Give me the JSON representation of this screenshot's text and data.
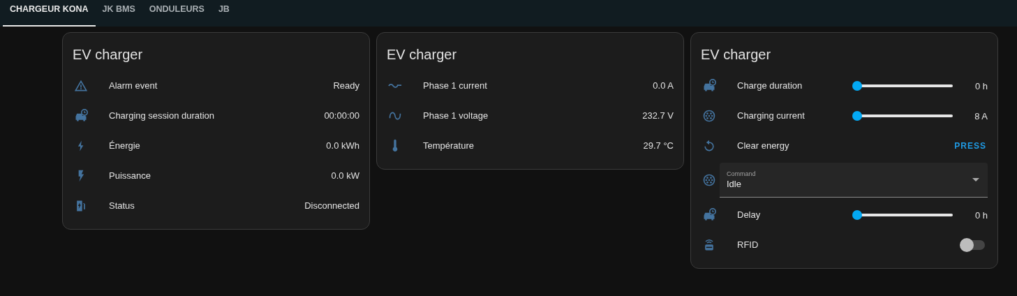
{
  "tabs": [
    {
      "label": "CHARGEUR KONA",
      "selected": true
    },
    {
      "label": "JK BMS",
      "selected": false
    },
    {
      "label": "ONDULEURS",
      "selected": false
    },
    {
      "label": "JB",
      "selected": false
    }
  ],
  "cards": [
    {
      "title": "EV charger",
      "rows": [
        {
          "kind": "sensor",
          "label": "Alarm event",
          "value": "Ready"
        },
        {
          "kind": "sensor",
          "label": "Charging session duration",
          "value": "00:00:00"
        },
        {
          "kind": "sensor",
          "label": "Énergie",
          "value": "0.0 kWh"
        },
        {
          "kind": "sensor",
          "label": "Puissance",
          "value": "0.0 kW"
        },
        {
          "kind": "sensor",
          "label": "Status",
          "value": "Disconnected"
        }
      ]
    },
    {
      "title": "EV charger",
      "rows": [
        {
          "kind": "sensor",
          "label": "Phase 1 current",
          "value": "0.0 A"
        },
        {
          "kind": "sensor",
          "label": "Phase 1 voltage",
          "value": "232.7 V"
        },
        {
          "kind": "sensor",
          "label": "Température",
          "value": "29.7 °C"
        }
      ]
    },
    {
      "title": "EV charger",
      "rows": [
        {
          "kind": "slider",
          "label": "Charge duration",
          "level": 0,
          "value": "0 h"
        },
        {
          "kind": "slider",
          "label": "Charging current",
          "level": 0,
          "value": "8 A"
        },
        {
          "kind": "button",
          "label": "Clear energy",
          "action": "PRESS"
        },
        {
          "kind": "select",
          "label": "Command",
          "value": "Idle"
        },
        {
          "kind": "slider",
          "label": "Delay",
          "level": 0,
          "value": "0 h"
        },
        {
          "kind": "switch",
          "label": "RFID",
          "on": false
        }
      ]
    }
  ]
}
